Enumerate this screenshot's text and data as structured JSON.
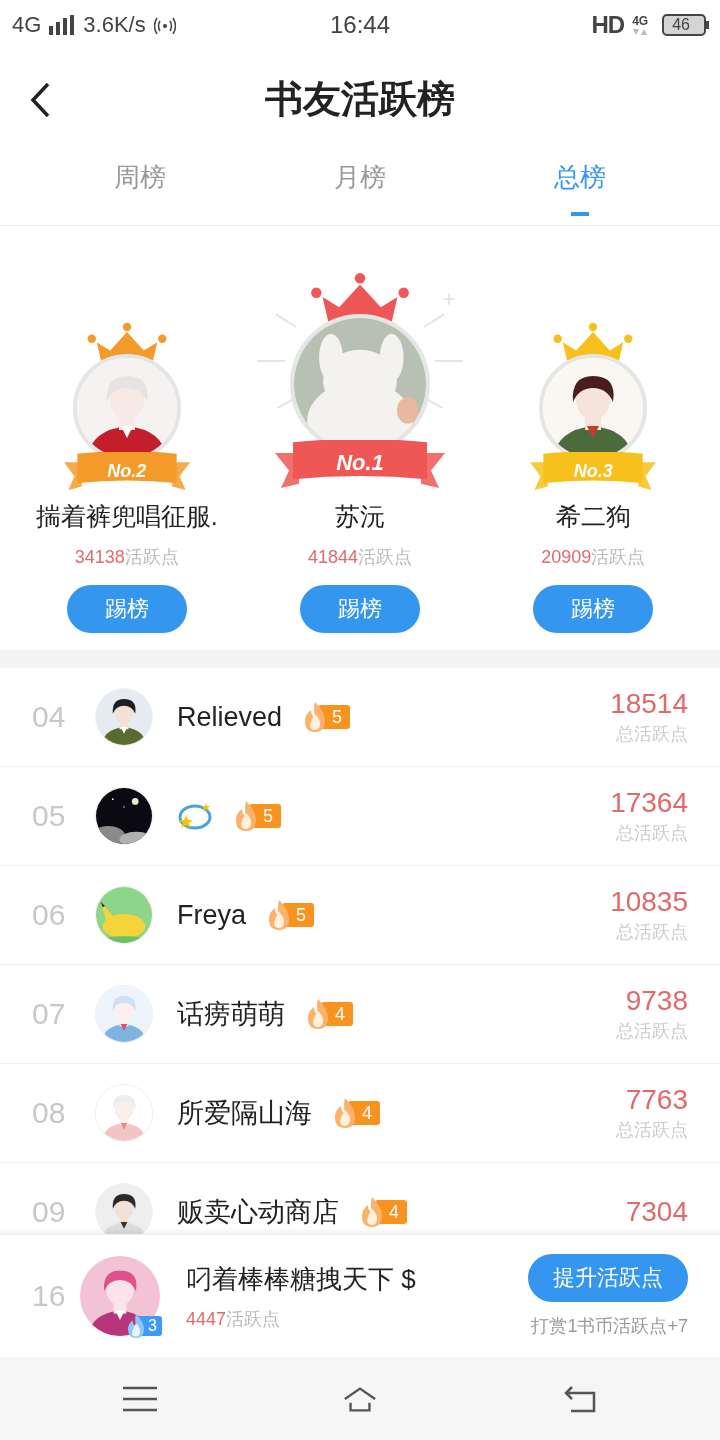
{
  "status_bar": {
    "network": "4G",
    "speed": "3.6K/s",
    "time": "16:44",
    "hd": "HD",
    "network_right": "4G",
    "battery": "46"
  },
  "header": {
    "title": "书友活跃榜"
  },
  "tabs": [
    {
      "label": "周榜",
      "selected": false
    },
    {
      "label": "月榜",
      "selected": false
    },
    {
      "label": "总榜",
      "selected": true
    }
  ],
  "podium": [
    {
      "rank_label": "No.2",
      "name": "揣着裤兜唱征服.",
      "score": "34138",
      "score_unit": "活跃点",
      "button": "踢榜",
      "color": "#f39a2b",
      "featured": false
    },
    {
      "rank_label": "No.1",
      "name": "苏沅",
      "score": "41844",
      "score_unit": "活跃点",
      "button": "踢榜",
      "color": "#ef5656",
      "featured": true
    },
    {
      "rank_label": "No.3",
      "name": "希二狗",
      "score": "20909",
      "score_unit": "活跃点",
      "button": "踢榜",
      "color": "#f8c01c",
      "featured": false
    }
  ],
  "ranking": [
    {
      "rank": "04",
      "kind": "text",
      "name": "Relieved",
      "badge": {
        "text": "5",
        "color": "#f7931e"
      },
      "score": "18514",
      "score_label": "总活跃点"
    },
    {
      "rank": "05",
      "kind": "icon",
      "badge": {
        "text": "5",
        "color": "#f7931e"
      },
      "score": "17364",
      "score_label": "总活跃点"
    },
    {
      "rank": "06",
      "kind": "text",
      "name": "Freya",
      "badge": {
        "text": "5",
        "color": "#f7931e"
      },
      "score": "10835",
      "score_label": "总活跃点"
    },
    {
      "rank": "07",
      "kind": "text",
      "name": "话痨萌萌",
      "badge": {
        "text": "4",
        "color": "#f7931e"
      },
      "score": "9738",
      "score_label": "总活跃点"
    },
    {
      "rank": "08",
      "kind": "text",
      "name": "所爱隔山海",
      "badge": {
        "text": "4",
        "color": "#f7931e"
      },
      "score": "7763",
      "score_label": "总活跃点"
    },
    {
      "rank": "09",
      "kind": "text",
      "name": "贩卖心动商店",
      "badge": {
        "text": "4",
        "color": "#f7931e"
      },
      "score": "7304"
    }
  ],
  "my_rank": {
    "rank": "16",
    "name": "叼着棒棒糖拽天下 $",
    "badge": {
      "text": "3",
      "color": "#3d9bf5"
    },
    "score": "4447",
    "score_unit": "活跃点",
    "button": "提升活跃点",
    "hint": "打赏1书币活跃点+7"
  }
}
